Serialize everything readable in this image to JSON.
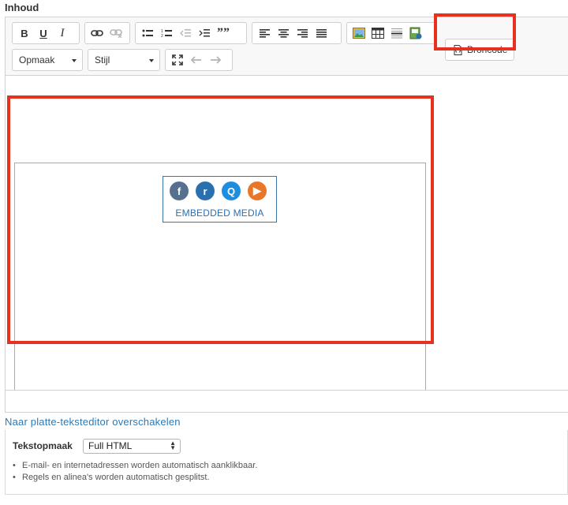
{
  "field": {
    "label": "Inhoud"
  },
  "toolbar": {
    "bold": "B",
    "underline": "U",
    "italic": "I",
    "blockquote": "””",
    "format_combo": "Opmaak",
    "style_combo": "Stijl",
    "source_label": "Broncode"
  },
  "content": {
    "media_label": "EMBEDDED MEDIA"
  },
  "switch_link": "Naar platte-teksteditor overschakelen",
  "text_format": {
    "label": "Tekstopmaak",
    "selected": "Full HTML",
    "tips": [
      "E-mail- en internetadressen worden automatisch aanklikbaar.",
      "Regels en alinea's worden automatisch gesplitst."
    ]
  },
  "colors": {
    "highlight": "#e8301f",
    "link": "#2a7ab8",
    "media_border": "#3a76a8"
  }
}
